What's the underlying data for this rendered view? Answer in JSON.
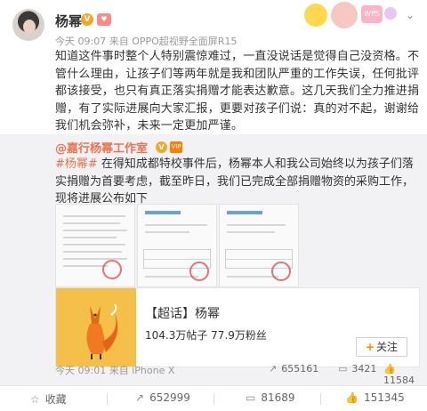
{
  "post": {
    "username": "杨幂",
    "v_badge": "V",
    "level_badge": "♥",
    "time": "今天 09:07",
    "source_prefix": "来自",
    "source": "OPPO超视野全面屏R15",
    "text": "知道这件事时整个人特别震惊难过，一直没说话是觉得自己没资格。不管什么理由，让孩子们等两年就是我和团队严重的工作失误，任何批评都该接受，也只有真正落实捐赠才能表达歉意。这几天我们全力推进捐赠，有了实际进展向大家汇报，更要对孩子们说：真的对不起，谢谢给我们机会弥补，未来一定更加严谨。"
  },
  "banner": {
    "tag": "WPS"
  },
  "repost": {
    "user": "@嘉行杨幂工作室",
    "v_badge": "V",
    "vip_badge": "VIP",
    "tag": "#杨幂#",
    "text": " 在得知成都特校事件后，杨幂本人和我公司始终以为孩子们落实捐赠为首要考虑，截至昨日，我们已完成全部捐赠物资的采购工作，现将进展公布如下",
    "link_card": {
      "title": "【超话】杨幂",
      "subtitle": "104.3万帖子 77.9万粉丝",
      "follow_plus": "+",
      "follow_label": "关注"
    },
    "time": "今天 09:01",
    "source_prefix": "来自",
    "source": "iPhone X",
    "stats": {
      "forward_icon": "↗",
      "forward": "655161",
      "comment_icon": "▭",
      "comment": "3421",
      "like_icon": "👍",
      "like": "11584"
    }
  },
  "footer": {
    "favorite_icon": "☆",
    "favorite": "收藏",
    "forward_icon": "↗",
    "forward": "652999",
    "comment_icon": "▭",
    "comment": "81689",
    "like_icon": "👍",
    "like": "151345"
  }
}
